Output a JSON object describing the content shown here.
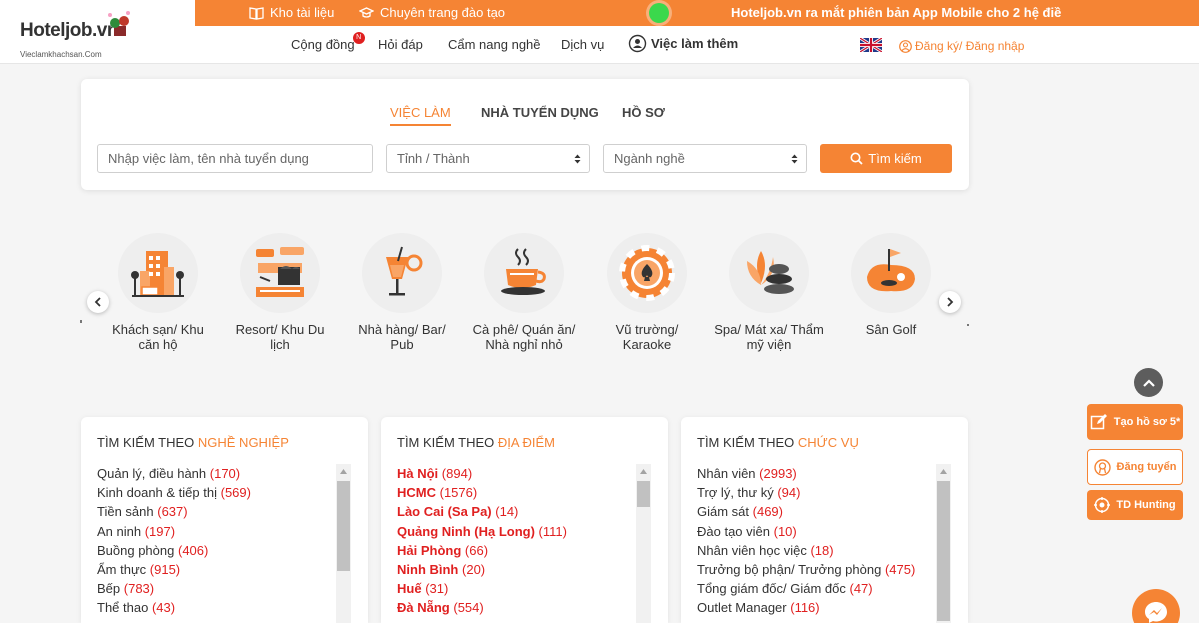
{
  "colors": {
    "accent": "#f58434",
    "count_red": "#e02020",
    "online_green": "#3bd84c"
  },
  "logo": {
    "text": "Hoteljob.vn",
    "subtitle": "Vieclamkhachsan.Com"
  },
  "topbar": {
    "library": "Kho tài liệu",
    "training": "Chuyên trang đào tạo",
    "announcement": "Hoteljob.vn ra mắt phiên bản App Mobile cho 2 hệ điề"
  },
  "nav": {
    "community": "Cộng đồng",
    "community_badge": "N",
    "qa": "Hỏi đáp",
    "handbook": "Cẩm nang nghề",
    "services": "Dịch vụ",
    "extra_jobs": "Việc làm thêm",
    "login": "Đăng ký/ Đăng nhập"
  },
  "search": {
    "tabs": [
      "VIỆC LÀM",
      "NHÀ TUYỂN DỤNG",
      "HỒ SƠ"
    ],
    "keyword_placeholder": "Nhập việc làm, tên nhà tuyển dụng",
    "province": "Tỉnh / Thành",
    "industry": "Ngành nghề",
    "button": "Tìm kiếm"
  },
  "categories": [
    {
      "label": "Khách sạn/ Khu căn hộ",
      "icon": "hotel-icon"
    },
    {
      "label": "Resort/ Khu Du lịch",
      "icon": "resort-icon"
    },
    {
      "label": "Nhà hàng/ Bar/ Pub",
      "icon": "cocktail-icon"
    },
    {
      "label": "Cà phê/ Quán ăn/ Nhà nghỉ nhỏ",
      "icon": "coffee-icon"
    },
    {
      "label": "Vũ trường/ Karaoke",
      "icon": "casino-chip-icon"
    },
    {
      "label": "Spa/ Mát xa/ Thẩm mỹ viện",
      "icon": "spa-stones-icon"
    },
    {
      "label": "Sân Golf",
      "icon": "golf-icon"
    }
  ],
  "panels": [
    {
      "title": "TÌM KIẾM THEO ",
      "accent": "NGHỀ NGHIỆP",
      "items": [
        {
          "name": "Quản lý, điều hành",
          "count": "(170)"
        },
        {
          "name": "Kinh doanh & tiếp thị",
          "count": "(569)"
        },
        {
          "name": "Tiền sảnh",
          "count": "(637)"
        },
        {
          "name": "An ninh",
          "count": "(197)"
        },
        {
          "name": "Buồng phòng",
          "count": "(406)"
        },
        {
          "name": "Ẩm thực",
          "count": "(915)"
        },
        {
          "name": "Bếp",
          "count": "(783)"
        },
        {
          "name": "Thể thao",
          "count": "(43)"
        }
      ]
    },
    {
      "title": "TÌM KIẾM THEO ",
      "accent": "ĐỊA ĐIỂM",
      "items": [
        {
          "name": "Hà Nội",
          "count": "(894)"
        },
        {
          "name": "HCMC",
          "count": "(1576)"
        },
        {
          "name": "Lào Cai (Sa Pa)",
          "count": "(14)"
        },
        {
          "name": "Quảng Ninh (Hạ Long)",
          "count": "(111)"
        },
        {
          "name": "Hải Phòng",
          "count": "(66)"
        },
        {
          "name": "Ninh Bình",
          "count": "(20)"
        },
        {
          "name": "Huế",
          "count": "(31)"
        },
        {
          "name": "Đà Nẵng",
          "count": "(554)"
        }
      ]
    },
    {
      "title": "TÌM KIẾM THEO ",
      "accent": "CHỨC VỤ",
      "items": [
        {
          "name": "Nhân viên",
          "count": "(2993)"
        },
        {
          "name": "Trợ lý, thư ký",
          "count": "(94)"
        },
        {
          "name": "Giám sát",
          "count": "(469)"
        },
        {
          "name": "Đào tạo viên",
          "count": "(10)"
        },
        {
          "name": "Nhân viên học việc",
          "count": "(18)"
        },
        {
          "name": "Trưởng bộ phận/ Trưởng phòng",
          "count": "(475)"
        },
        {
          "name": "Tổng giám đốc/ Giám đốc",
          "count": "(47)"
        },
        {
          "name": "Outlet Manager",
          "count": "(116)"
        }
      ]
    }
  ],
  "side": {
    "create_cv": "Tạo hồ sơ 5*",
    "post_job": "Đăng tuyển",
    "hunting": "TD Hunting"
  }
}
